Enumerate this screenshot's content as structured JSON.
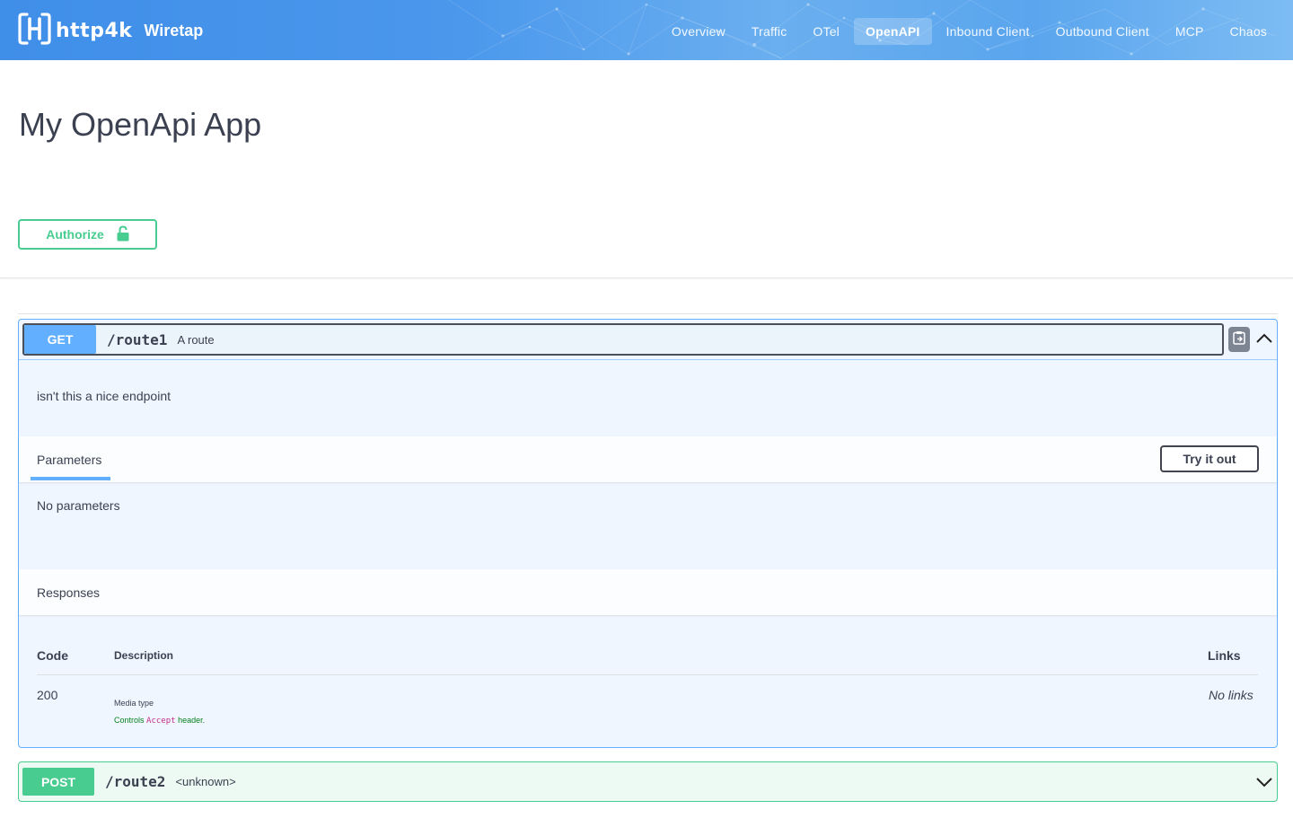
{
  "header": {
    "brand": "http4k",
    "subtitle": "Wiretap",
    "nav": [
      {
        "label": "Overview",
        "active": false
      },
      {
        "label": "Traffic",
        "active": false
      },
      {
        "label": "OTel",
        "active": false
      },
      {
        "label": "OpenAPI",
        "active": true
      },
      {
        "label": "Inbound Client",
        "active": false
      },
      {
        "label": "Outbound Client",
        "active": false
      },
      {
        "label": "MCP",
        "active": false
      },
      {
        "label": "Chaos",
        "active": false
      }
    ]
  },
  "page": {
    "title": "My OpenApi App",
    "authorize_label": "Authorize"
  },
  "operations": [
    {
      "method": "GET",
      "path": "/route1",
      "summary": "A route",
      "expanded": true,
      "description": "isn't this a nice endpoint",
      "parameters_tab": "Parameters",
      "try_it_out": "Try it out",
      "no_parameters": "No parameters",
      "responses_title": "Responses",
      "responses_headers": {
        "code": "Code",
        "description": "Description",
        "links": "Links"
      },
      "responses": [
        {
          "code": "200",
          "media_type_label": "Media type",
          "controls_prefix": "Controls",
          "controls_accept": "Accept",
          "controls_suffix": "header.",
          "links": "No links"
        }
      ],
      "color": "#61affe"
    },
    {
      "method": "POST",
      "path": "/route2",
      "summary": "<unknown>",
      "expanded": false,
      "color": "#49cc90"
    }
  ],
  "icons": {
    "logo": "http4k-logo-icon",
    "lock": "unlocked-padlock-icon",
    "copy": "copy-to-clipboard-icon",
    "collapse": "chevron-up-icon",
    "expand": "chevron-down-icon"
  }
}
